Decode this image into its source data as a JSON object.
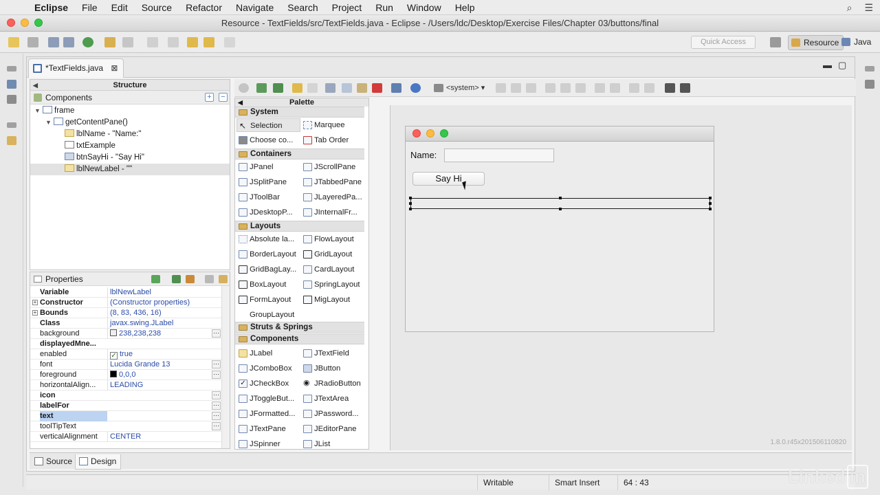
{
  "menubar": {
    "app": "Eclipse",
    "items": [
      "File",
      "Edit",
      "Source",
      "Refactor",
      "Navigate",
      "Search",
      "Project",
      "Run",
      "Window",
      "Help"
    ]
  },
  "window": {
    "title": "Resource - TextFields/src/TextFields.java - Eclipse - /Users/ldc/Desktop/Exercise Files/Chapter 03/buttons/final"
  },
  "toolbar": {
    "quick_access": "Quick Access",
    "perspectives": [
      "Resource",
      "Java"
    ]
  },
  "editor": {
    "tab_label": "*TextFields.java",
    "close_glyph": "⊠"
  },
  "structure": {
    "title": "Structure",
    "components_label": "Components",
    "tree": [
      {
        "label": "frame",
        "level": 0,
        "icon": "frame"
      },
      {
        "label": "getContentPane()",
        "level": 1,
        "icon": "pane"
      },
      {
        "label": "lblName - \"Name:\"",
        "level": 2,
        "icon": "label"
      },
      {
        "label": "txtExample",
        "level": 2,
        "icon": "textfield"
      },
      {
        "label": "btnSayHi - \"Say Hi\"",
        "level": 2,
        "icon": "button"
      },
      {
        "label": "lblNewLabel - \"\"",
        "level": 2,
        "icon": "label",
        "selected": true
      }
    ]
  },
  "properties": {
    "title": "Properties",
    "rows": [
      {
        "key": "Variable",
        "value": "lblNewLabel",
        "bold": true
      },
      {
        "key": "Constructor",
        "value": "(Constructor properties)",
        "bold": true,
        "expand": true
      },
      {
        "key": "Bounds",
        "value": "(8, 83, 436, 16)",
        "bold": true,
        "expand": true
      },
      {
        "key": "Class",
        "value": "javax.swing.JLabel",
        "bold": true
      },
      {
        "key": "background",
        "value": "238,238,238",
        "swatch": "#eeeeee",
        "dots": true
      },
      {
        "key": "displayedMne...",
        "value": "",
        "bold": true
      },
      {
        "key": "enabled",
        "value": "true",
        "check": true
      },
      {
        "key": "font",
        "value": "Lucida Grande 13",
        "dots": true
      },
      {
        "key": "foreground",
        "value": "0,0,0",
        "swatch": "#000000",
        "dots": true
      },
      {
        "key": "horizontalAlign...",
        "value": "LEADING"
      },
      {
        "key": "icon",
        "value": "",
        "bold": true,
        "dots": true
      },
      {
        "key": "labelFor",
        "value": "",
        "bold": true,
        "dots": true
      },
      {
        "key": "text",
        "value": "",
        "bold": true,
        "dots": true,
        "highlight": true
      },
      {
        "key": "toolTipText",
        "value": "",
        "dots": true
      },
      {
        "key": "verticalAlignment",
        "value": "CENTER"
      }
    ]
  },
  "palette": {
    "title": "Palette",
    "system_dropdown": "<system>",
    "categories": [
      {
        "name": "System",
        "items": [
          "Selection",
          "Marquee",
          "Choose co...",
          "Tab Order"
        ]
      },
      {
        "name": "Containers",
        "items": [
          "JPanel",
          "JScrollPane",
          "JSplitPane",
          "JTabbedPane",
          "JToolBar",
          "JLayeredPa...",
          "JDesktopP...",
          "JInternalFr..."
        ]
      },
      {
        "name": "Layouts",
        "items": [
          "Absolute la...",
          "FlowLayout",
          "BorderLayout",
          "GridLayout",
          "GridBagLay...",
          "CardLayout",
          "BoxLayout",
          "SpringLayout",
          "FormLayout",
          "MigLayout",
          "GroupLayout"
        ]
      },
      {
        "name": "Struts & Springs",
        "items": []
      },
      {
        "name": "Components",
        "items": [
          "JLabel",
          "JTextField",
          "JComboBox",
          "JButton",
          "JCheckBox",
          "JRadioButton",
          "JToggleBut...",
          "JTextArea",
          "JFormatted...",
          "JPassword...",
          "JTextPane",
          "JEditorPane",
          "JSpinner",
          "JList"
        ]
      }
    ]
  },
  "design": {
    "name_label": "Name:",
    "button_label": "Say Hi",
    "version": "1.8.0.r45x201506110820"
  },
  "bottom_tabs": [
    "Source",
    "Design"
  ],
  "status": {
    "writable": "Writable",
    "insert": "Smart Insert",
    "position": "64 : 43"
  },
  "watermark": {
    "text": "Linked",
    "badge": "in"
  },
  "colors": {
    "accent": "#4a6ea8",
    "selection": "#bcd3f1"
  }
}
